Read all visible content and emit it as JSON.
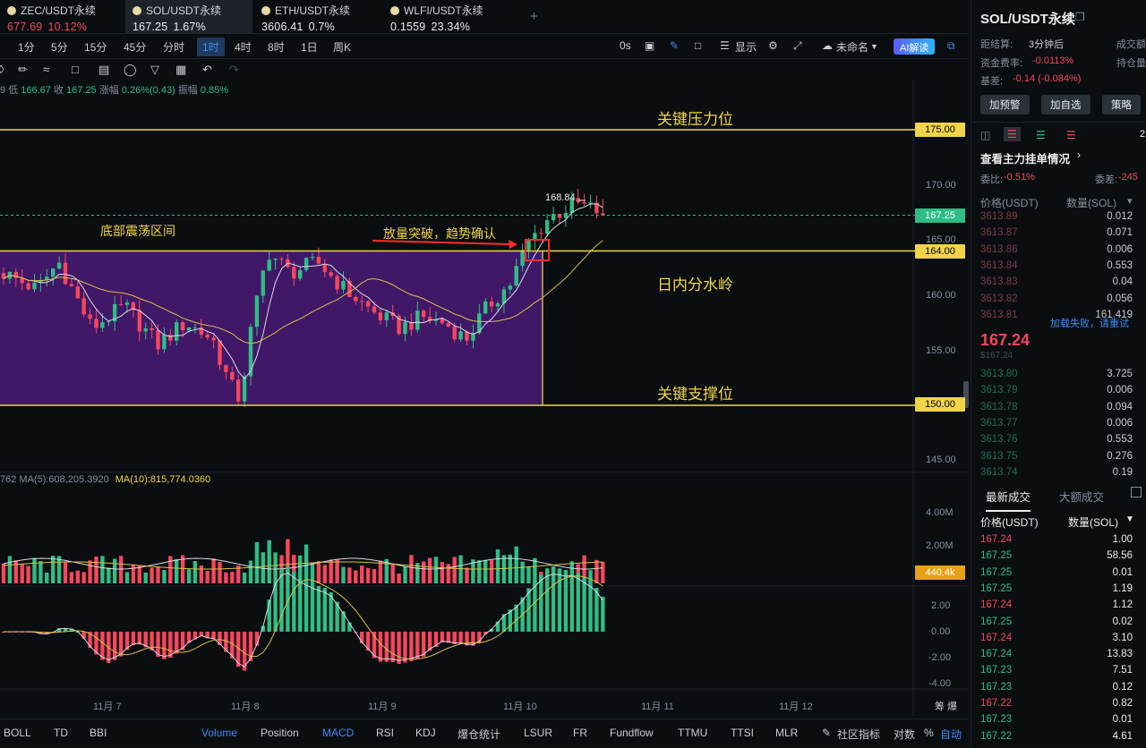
{
  "tabs": [
    {
      "name": "ZEC/USDT永续",
      "price": "677.69",
      "change": "10.12%",
      "color": "red"
    },
    {
      "name": "SOL/USDT永续",
      "price": "167.25",
      "change": "1.67%",
      "color": "white"
    },
    {
      "name": "ETH/USDT永续",
      "price": "3606.41",
      "change": "0.7%",
      "color": "white"
    },
    {
      "name": "WLFI/USDT永续",
      "price": "0.1559",
      "change": "23.34%",
      "color": "white"
    }
  ],
  "tab_plus": "+",
  "intervals": [
    "1分",
    "5分",
    "15分",
    "45分",
    "分时",
    "1时",
    "4时",
    "8时",
    "1日",
    "周K"
  ],
  "active_interval": "1时",
  "toolbar_right": {
    "zero_s": "0s",
    "display": "显示",
    "unnamed": "未命名",
    "ai": "AI解读"
  },
  "ohlc": {
    "low_label": "9 低",
    "low": "166.67",
    "close_label": "收",
    "close": "167.25",
    "amp_label": "涨幅",
    "amp": "0.26%(0.43)",
    "vib_label": "振幅",
    "vib": "0.85%"
  },
  "annotations": {
    "resistance": "关键压力位",
    "range": "底部震荡区间",
    "breakout": "放量突破，趋势确认",
    "pivot": "日内分水岭",
    "support": "关键支撑位"
  },
  "price_levels": {
    "resistance": "175.00",
    "pivot": "164.00",
    "support": "150.00",
    "current": "167.25",
    "high_marker": "168.84"
  },
  "y_ticks": [
    "170.00",
    "165.00",
    "160.00",
    "155.00",
    "145.00"
  ],
  "volume": {
    "ma_label": "762  MA(5):608,205.3920",
    "ma10_label": "MA(10):815,774.0360",
    "ticks": [
      "4.00M",
      "2.00M"
    ],
    "current": "440.4k"
  },
  "macd_ticks": [
    "2.00",
    "0.00",
    "-2.00",
    "-4.00"
  ],
  "dates": [
    "11月 7",
    "11月 8",
    "11月 9",
    "11月 10",
    "11月 11",
    "11月 12"
  ],
  "axis_corner": "筹 爆",
  "indicators": [
    "BOLL",
    "TD",
    "BBI",
    "Volume",
    "Position",
    "MACD",
    "RSI",
    "KDJ",
    "爆仓统计",
    "LSUR",
    "FR",
    "Fundflow",
    "TTMU",
    "TTSI",
    "MLR",
    "社区指标",
    "对数",
    "%",
    "自动"
  ],
  "active_indicators": [
    "Volume",
    "MACD",
    "自动"
  ],
  "right_panel": {
    "title": "SOL/USDT永续",
    "settle_label": "距结算:",
    "settle": "3分钟后",
    "deal_label": "成交额",
    "funding_label": "资金费率:",
    "funding": "-0.0113%",
    "oi_label": "持仓量",
    "basis_label": "基差:",
    "basis": "-0.14 (-0.084%)",
    "buttons": [
      "加预警",
      "加自选",
      "策略"
    ],
    "depth_digit": "2",
    "main_orders": "查看主力挂单情况",
    "ratio_label": "委比:",
    "ratio": "-0.51%",
    "diff_label": "委差:",
    "diff": "-245",
    "ob_headers": [
      "价格(USDT)",
      "数量(SOL)"
    ],
    "asks": [
      [
        "3613.89",
        "0.012"
      ],
      [
        "3613.87",
        "0.071"
      ],
      [
        "3613.86",
        "0.006"
      ],
      [
        "3613.84",
        "0.553"
      ],
      [
        "3613.83",
        "0.04"
      ],
      [
        "3613.82",
        "0.056"
      ],
      [
        "3613.81",
        "161.419"
      ]
    ],
    "load_fail": "加载失败，请重试",
    "mid_price": "167.24",
    "mid_sub": "$167.24",
    "bids": [
      [
        "3613.80",
        "3.725"
      ],
      [
        "3613.79",
        "0.006"
      ],
      [
        "3613.78",
        "0.094"
      ],
      [
        "3613.77",
        "0.006"
      ],
      [
        "3613.76",
        "0.553"
      ],
      [
        "3613.75",
        "0.276"
      ],
      [
        "3613.74",
        "0.19"
      ]
    ],
    "trade_tabs": [
      "最新成交",
      "大额成交"
    ],
    "trade_headers": [
      "价格(USDT)",
      "数量(SOL)"
    ],
    "trades": [
      [
        "167.24",
        "1.00",
        "red"
      ],
      [
        "167.25",
        "58.56",
        "green"
      ],
      [
        "167.25",
        "0.01",
        "green"
      ],
      [
        "167.25",
        "1.19",
        "green"
      ],
      [
        "167.24",
        "1.12",
        "red"
      ],
      [
        "167.25",
        "0.02",
        "green"
      ],
      [
        "167.24",
        "3.10",
        "red"
      ],
      [
        "167.24",
        "13.83",
        "green"
      ],
      [
        "167.23",
        "7.51",
        "green"
      ],
      [
        "167.23",
        "0.12",
        "green"
      ],
      [
        "167.22",
        "0.82",
        "red"
      ],
      [
        "167.23",
        "0.01",
        "green"
      ],
      [
        "167.22",
        "4.61",
        "green"
      ]
    ]
  },
  "colors": {
    "up": "#2ebd85",
    "down": "#f6465d",
    "level": "#f0d54a",
    "box": "#4b1a78",
    "ma_fast": "#d9d9e0",
    "ma_slow": "#d8c04a"
  }
}
